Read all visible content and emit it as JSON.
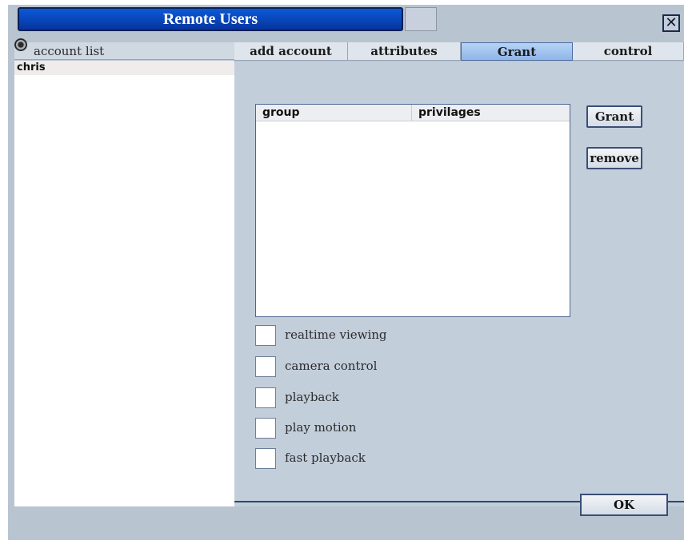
{
  "window": {
    "title": "Remote Users",
    "close_symbol": "✕"
  },
  "accounts": {
    "header_label": "account list",
    "items": [
      "chris"
    ]
  },
  "tabs": [
    {
      "label": "add account",
      "active": false
    },
    {
      "label": "attributes",
      "active": false
    },
    {
      "label": "Grant",
      "active": true
    },
    {
      "label": "control",
      "active": false
    }
  ],
  "grant": {
    "columns": [
      "group",
      "privilages"
    ],
    "rows": [],
    "grant_button": "Grant",
    "remove_button": "remove",
    "permissions": [
      {
        "label": "realtime viewing",
        "checked": false
      },
      {
        "label": "camera control",
        "checked": false
      },
      {
        "label": "playback",
        "checked": false
      },
      {
        "label": "play motion",
        "checked": false
      },
      {
        "label": "fast playback",
        "checked": false
      }
    ]
  },
  "footer": {
    "ok_label": "OK"
  },
  "colors": {
    "title_blue": "#0b5ad6",
    "active_tab": "#8fb5e8",
    "panel_bg": "#c3cedb"
  }
}
